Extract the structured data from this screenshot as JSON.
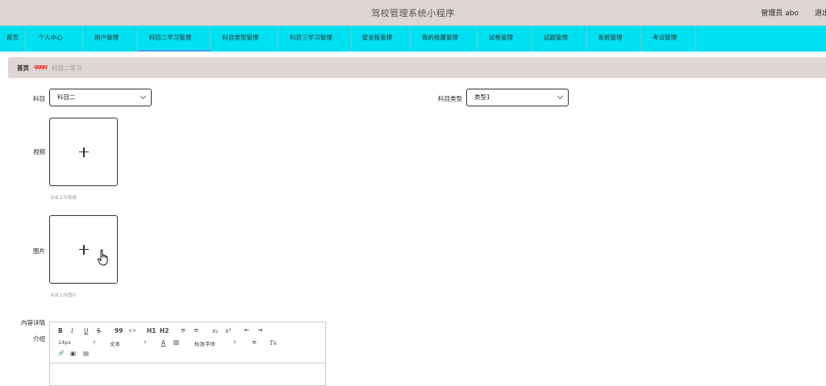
{
  "header": {
    "title": "驾校管理系统小程序",
    "user": "管理员 abo",
    "logout": "退出"
  },
  "nav": {
    "items": [
      {
        "label": "首页",
        "dropdown": false
      },
      {
        "label": "个人中心",
        "dropdown": true
      },
      {
        "label": "用户管理",
        "dropdown": true
      },
      {
        "label": "科目二学习管理",
        "dropdown": true,
        "active": true
      },
      {
        "label": "科目类型管理",
        "dropdown": true
      },
      {
        "label": "科目三学习管理",
        "dropdown": true
      },
      {
        "label": "留言板管理",
        "dropdown": true
      },
      {
        "label": "我的收藏管理",
        "dropdown": true
      },
      {
        "label": "试卷管理",
        "dropdown": true
      },
      {
        "label": "试题管理",
        "dropdown": true
      },
      {
        "label": "系统管理",
        "dropdown": true
      },
      {
        "label": "考试管理",
        "dropdown": true
      }
    ]
  },
  "breadcrumb": {
    "home": "首页",
    "separator": "qqqq",
    "current": "科目二学习"
  },
  "form": {
    "subject_label": "科目",
    "subject_value": "科目二",
    "type_label": "科目类型",
    "type_value": "类型1",
    "video_label": "视频",
    "video_hint": "点击上传视频",
    "image_label": "图片",
    "image_hint": "点击上传图片",
    "detail_label_1": "内容详情",
    "detail_label_2": "介绍"
  },
  "editor": {
    "row1": {
      "bold": "B",
      "italic": "I",
      "underline": "U",
      "strike": "S",
      "quote": "99",
      "code": "<>",
      "h1": "H1",
      "h2": "H2",
      "ordered_list": "≡",
      "bullet_list": "≡",
      "sub": "x₂",
      "sup": "x²",
      "outdent": "⇤",
      "indent": "⇥"
    },
    "row2": {
      "size": "14px",
      "format": "文本",
      "color": "A",
      "bg": "▨",
      "font": "标准字体",
      "align": "≡",
      "clear": "Tx"
    },
    "row3": {
      "link": "🔗",
      "image": "▣",
      "video": "▤"
    }
  },
  "colors": {
    "header_bg": "#ddd6d4",
    "nav_bg": "#00e0f0",
    "breadcrumb_bg": "#ded6d4",
    "separator": "#e33333"
  }
}
